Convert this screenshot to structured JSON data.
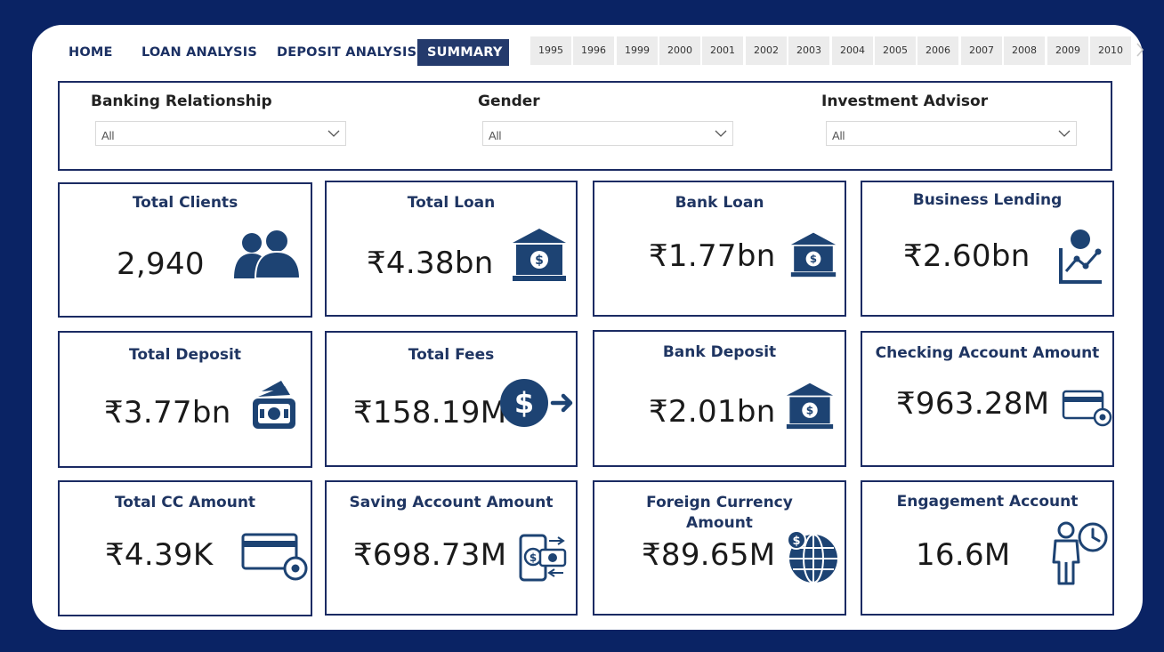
{
  "nav": {
    "tabs": [
      {
        "label": "HOME",
        "active": false
      },
      {
        "label": "LOAN ANALYSIS",
        "active": false
      },
      {
        "label": "DEPOSIT ANALYSIS",
        "active": false
      },
      {
        "label": "SUMMARY",
        "active": true
      }
    ]
  },
  "years": [
    "1995",
    "1996",
    "1999",
    "2000",
    "2001",
    "2002",
    "2003",
    "2004",
    "2005",
    "2006",
    "2007",
    "2008",
    "2009",
    "2010"
  ],
  "filters": [
    {
      "label": "Banking Relationship",
      "value": "All"
    },
    {
      "label": "Gender",
      "value": "All"
    },
    {
      "label": "Investment Advisor",
      "value": "All"
    }
  ],
  "cards": [
    {
      "title": "Total Clients",
      "value": "2,940",
      "icon": "users-icon"
    },
    {
      "title": "Total Loan",
      "value": "₹4.38bn",
      "icon": "bank-icon"
    },
    {
      "title": "Bank Loan",
      "value": "₹1.77bn",
      "icon": "bank-icon"
    },
    {
      "title": "Business Lending",
      "value": "₹2.60bn",
      "icon": "growth-chart-icon"
    },
    {
      "title": "Total Deposit",
      "value": "₹3.77bn",
      "icon": "cash-deposit-icon"
    },
    {
      "title": "Total Fees",
      "value": "₹158.19M",
      "icon": "dollar-transfer-icon"
    },
    {
      "title": "Bank Deposit",
      "value": "₹2.01bn",
      "icon": "bank-icon"
    },
    {
      "title": "Checking Account Amount",
      "value": "₹963.28M",
      "icon": "card-settings-icon"
    },
    {
      "title": "Total CC Amount",
      "value": "₹4.39K",
      "icon": "card-settings-icon"
    },
    {
      "title": "Saving Account Amount",
      "value": "₹698.73M",
      "icon": "mobile-payment-icon"
    },
    {
      "title": "Foreign Currency Amount",
      "value": "₹89.65M",
      "icon": "globe-dollar-icon"
    },
    {
      "title": "Engagement Account",
      "value": "16.6M",
      "icon": "person-clock-icon"
    }
  ],
  "colors": {
    "background": "#0a2364",
    "accent": "#1b2b63",
    "icon": "#1d4373",
    "active_tab": "#243a6c"
  }
}
